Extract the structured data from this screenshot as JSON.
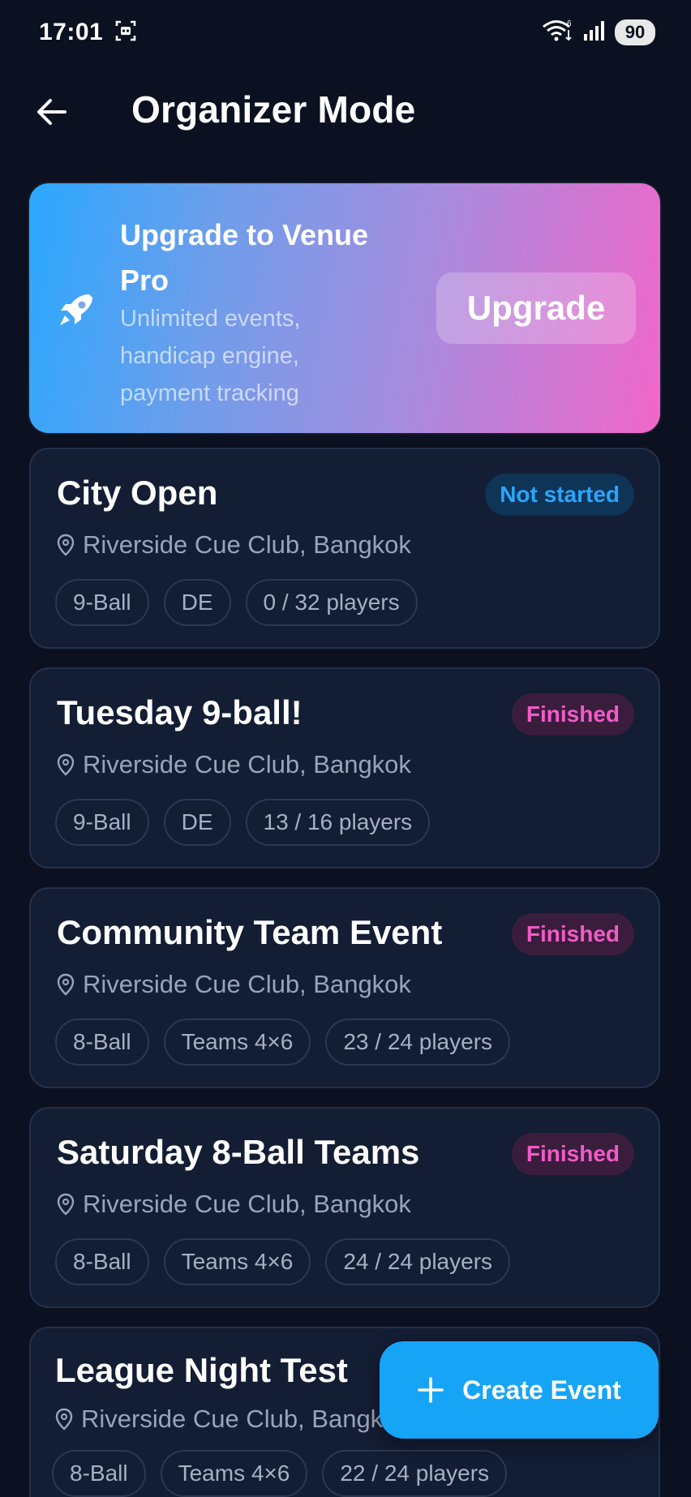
{
  "status_bar": {
    "time": "17:01",
    "battery": "90",
    "wifi_label": "6"
  },
  "header": {
    "title": "Organizer Mode"
  },
  "promo": {
    "title": "Upgrade to Venue Pro",
    "subtitle": "Unlimited events, handicap engine, payment tracking",
    "button_label": "Upgrade"
  },
  "events": [
    {
      "title": "City Open",
      "status": "Not started",
      "status_kind": "not-started",
      "location": "Riverside Cue Club, Bangkok",
      "chips": [
        "9-Ball",
        "DE",
        "0 / 32 players"
      ]
    },
    {
      "title": "Tuesday 9-ball!",
      "status": "Finished",
      "status_kind": "finished",
      "location": "Riverside Cue Club, Bangkok",
      "chips": [
        "9-Ball",
        "DE",
        "13 / 16 players"
      ]
    },
    {
      "title": "Community Team Event",
      "status": "Finished",
      "status_kind": "finished",
      "location": "Riverside Cue Club, Bangkok",
      "chips": [
        "8-Ball",
        "Teams 4×6",
        "23 / 24 players"
      ]
    },
    {
      "title": "Saturday 8-Ball Teams",
      "status": "Finished",
      "status_kind": "finished",
      "location": "Riverside Cue Club, Bangkok",
      "chips": [
        "8-Ball",
        "Teams 4×6",
        "24 / 24 players"
      ]
    },
    {
      "title": "League Night Test",
      "status": "",
      "status_kind": "",
      "location": "Riverside Cue Club, Bangkok",
      "chips": [
        "8-Ball",
        "Teams 4×6",
        "22 / 24 players"
      ]
    }
  ],
  "fab": {
    "label": "Create Event"
  },
  "colors": {
    "background": "#0b1120",
    "card": "#131d33",
    "accent_blue": "#16a4f7",
    "accent_pink": "#f25bc6"
  }
}
